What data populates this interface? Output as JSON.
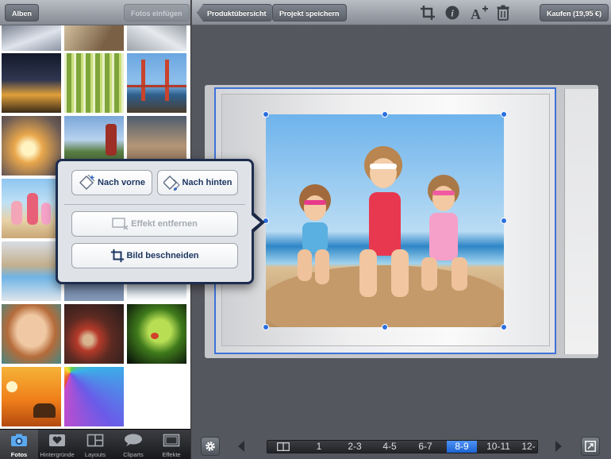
{
  "left_toolbar": {
    "albums_label": "Alben",
    "insert_photos_label": "Fotos einfügen"
  },
  "top_toolbar": {
    "overview_label": "Produktübersicht",
    "save_project_label": "Projekt speichern",
    "buy_label": "Kaufen (19,95 €)",
    "icons": [
      "crop-icon",
      "info-icon",
      "add-text-icon",
      "trash-icon"
    ]
  },
  "popover": {
    "bring_forward_label": "Nach vorne",
    "send_backward_label": "Nach hinten",
    "remove_effect_label": "Effekt entfernen",
    "crop_image_label": "Bild beschneiden"
  },
  "tabs": [
    {
      "label": "Fotos",
      "icon": "camera-icon",
      "active": true
    },
    {
      "label": "Hintergründe",
      "icon": "heart-icon",
      "active": false
    },
    {
      "label": "Layouts",
      "icon": "layout-icon",
      "active": false
    },
    {
      "label": "Cliparts",
      "icon": "speech-bubble-icon",
      "active": false
    },
    {
      "label": "Effekte",
      "icon": "frame-icon",
      "active": false
    }
  ],
  "pager": {
    "pages": [
      "1",
      "2-3",
      "4-5",
      "6-7",
      "8-9",
      "10-11",
      "12-"
    ],
    "active": "8-9"
  },
  "colors": {
    "selection": "#3f72d8",
    "popover_border": "#1e2d4e",
    "active_page": "#2a6fe0"
  }
}
